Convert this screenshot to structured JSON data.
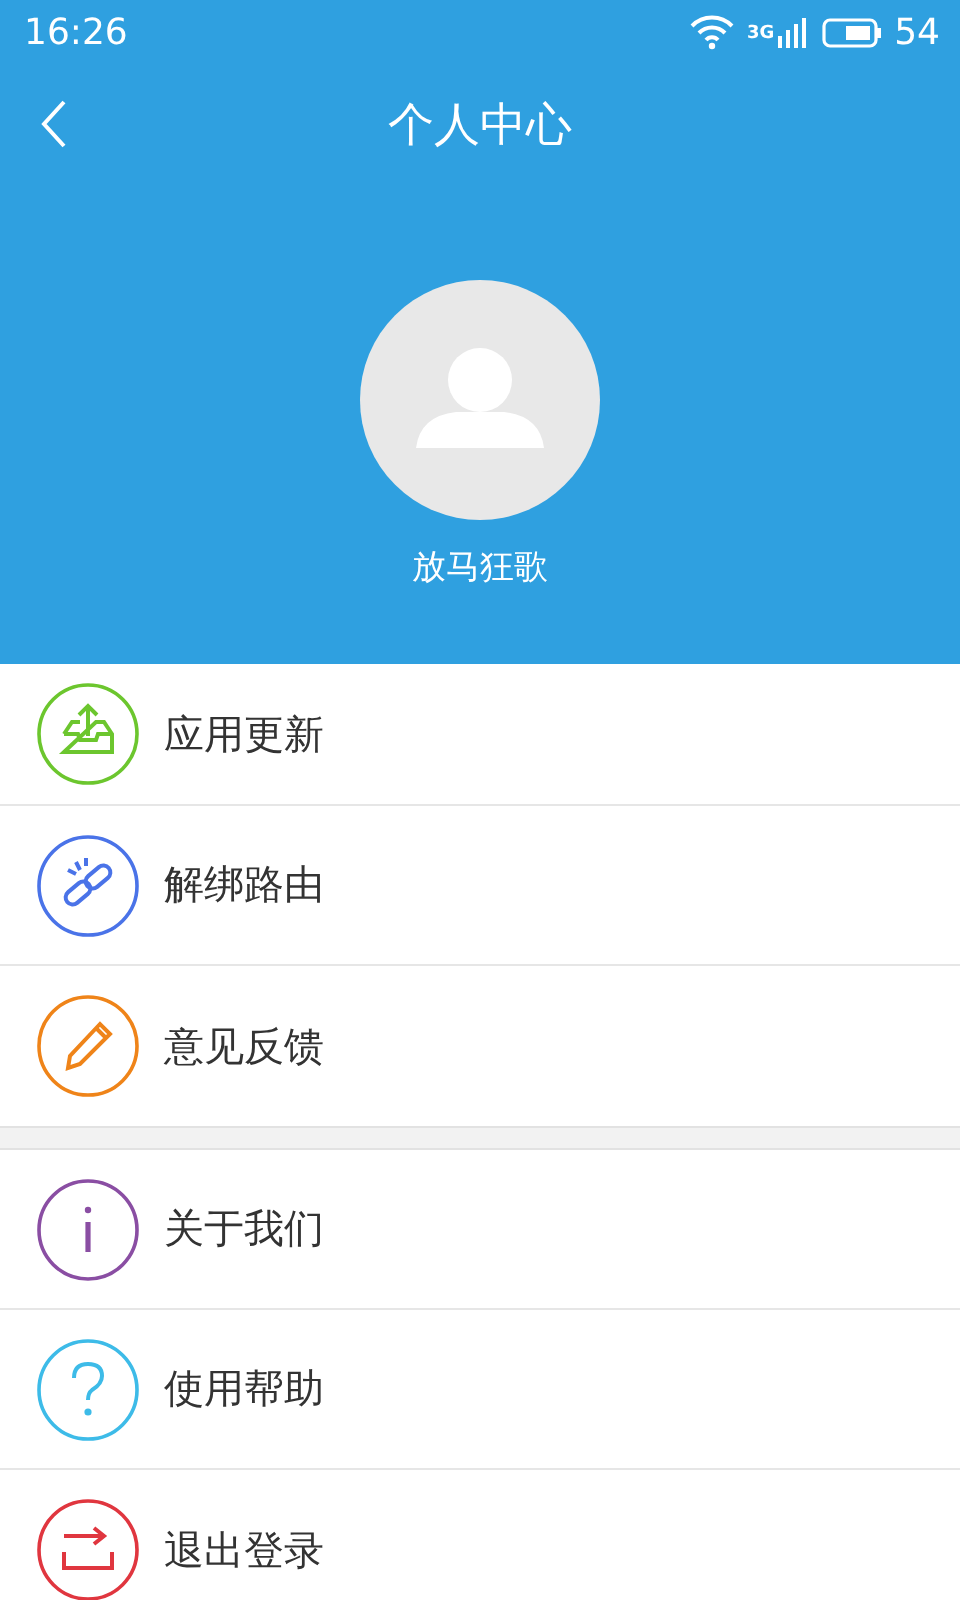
{
  "status_bar": {
    "time": "16:26",
    "network": "3G",
    "battery": "54"
  },
  "header": {
    "title": "个人中心",
    "user_name": "放马狂歌"
  },
  "menu_groups": [
    {
      "items": [
        {
          "label": "应用更新",
          "kind": "upload",
          "color": "#6cc62e"
        },
        {
          "label": "解绑路由",
          "kind": "unlink",
          "color": "#4a73e8"
        },
        {
          "label": "意见反馈",
          "kind": "pencil",
          "color": "#ef8419"
        }
      ]
    },
    {
      "items": [
        {
          "label": "关于我们",
          "kind": "info",
          "color": "#8a4ea3"
        },
        {
          "label": "使用帮助",
          "kind": "help",
          "color": "#3dbbe8"
        },
        {
          "label": "退出登录",
          "kind": "logout",
          "color": "#e0363f"
        }
      ]
    }
  ]
}
